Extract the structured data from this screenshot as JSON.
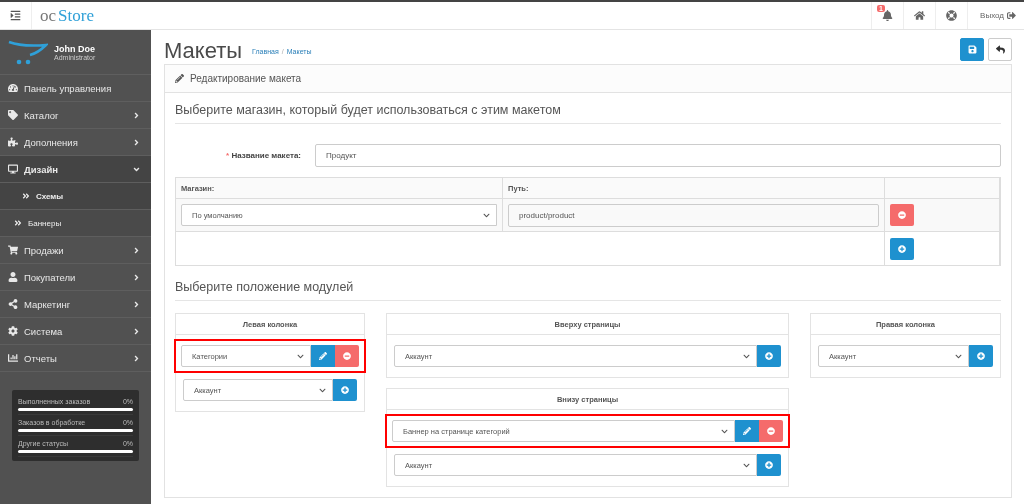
{
  "header": {
    "logo": {
      "prefix": "oc",
      "name": "Store"
    },
    "notifications_badge": "1",
    "logout": "Выход"
  },
  "profile": {
    "name": "John Doe",
    "role": "Administrator"
  },
  "sidebar": {
    "items": [
      {
        "label": "Панель управления",
        "has_arrow": false,
        "expanded": false
      },
      {
        "label": "Каталог",
        "has_arrow": true,
        "expanded": false
      },
      {
        "label": "Дополнения",
        "has_arrow": true,
        "expanded": false
      },
      {
        "label": "Дизайн",
        "has_arrow": true,
        "expanded": true,
        "children": [
          {
            "label": "Схемы",
            "selected": true
          },
          {
            "label": "Баннеры",
            "selected": false
          }
        ]
      },
      {
        "label": "Продажи",
        "has_arrow": true,
        "expanded": false
      },
      {
        "label": "Покупатели",
        "has_arrow": true,
        "expanded": false
      },
      {
        "label": "Маркетинг",
        "has_arrow": true,
        "expanded": false
      },
      {
        "label": "Система",
        "has_arrow": true,
        "expanded": false
      },
      {
        "label": "Отчеты",
        "has_arrow": true,
        "expanded": false
      }
    ],
    "stats": [
      {
        "label": "Выполненных заказов",
        "value": "0%",
        "level": 0
      },
      {
        "label": "Заказов в обработке",
        "value": "0%",
        "level": 0
      },
      {
        "label": "Другие статусы",
        "value": "0%",
        "level": 0
      }
    ]
  },
  "page": {
    "title": "Макеты",
    "breadcrumbs": [
      "Главная",
      "Макеты"
    ],
    "breadcrumb_separator": "/"
  },
  "panel": {
    "title": "Редактирование макета",
    "store_heading": "Выберите магазин, который будет использоваться с этим макетом",
    "name_field": {
      "label": "Название макета:",
      "required": true,
      "required_mark": "*",
      "value": "Продукт"
    },
    "routes_table": {
      "columns": [
        "Магазин:",
        "Путь:"
      ],
      "rows": [
        {
          "store": "По умолчанию",
          "route": "product/product"
        }
      ]
    },
    "modules_heading": "Выберите положение модулей",
    "position_columns": [
      {
        "positions": [
          {
            "title": "Левая колонка",
            "modules": [
              {
                "kind": "existing",
                "value": "Категории",
                "highlighted": true
              },
              {
                "kind": "add",
                "value": "Аккаунт",
                "highlighted": false
              }
            ]
          }
        ]
      },
      {
        "positions": [
          {
            "title": "Вверху страницы",
            "modules": [
              {
                "kind": "add",
                "value": "Аккаунт",
                "highlighted": false
              }
            ]
          },
          {
            "title": "Внизу страницы",
            "modules": [
              {
                "kind": "existing",
                "value": "Баннер на странице категорий",
                "highlighted": true
              },
              {
                "kind": "add",
                "value": "Аккаунт",
                "highlighted": false
              }
            ]
          }
        ]
      },
      {
        "positions": [
          {
            "title": "Правая колонка",
            "modules": [
              {
                "kind": "add",
                "value": "Аккаунт",
                "highlighted": false
              }
            ]
          }
        ]
      }
    ]
  }
}
